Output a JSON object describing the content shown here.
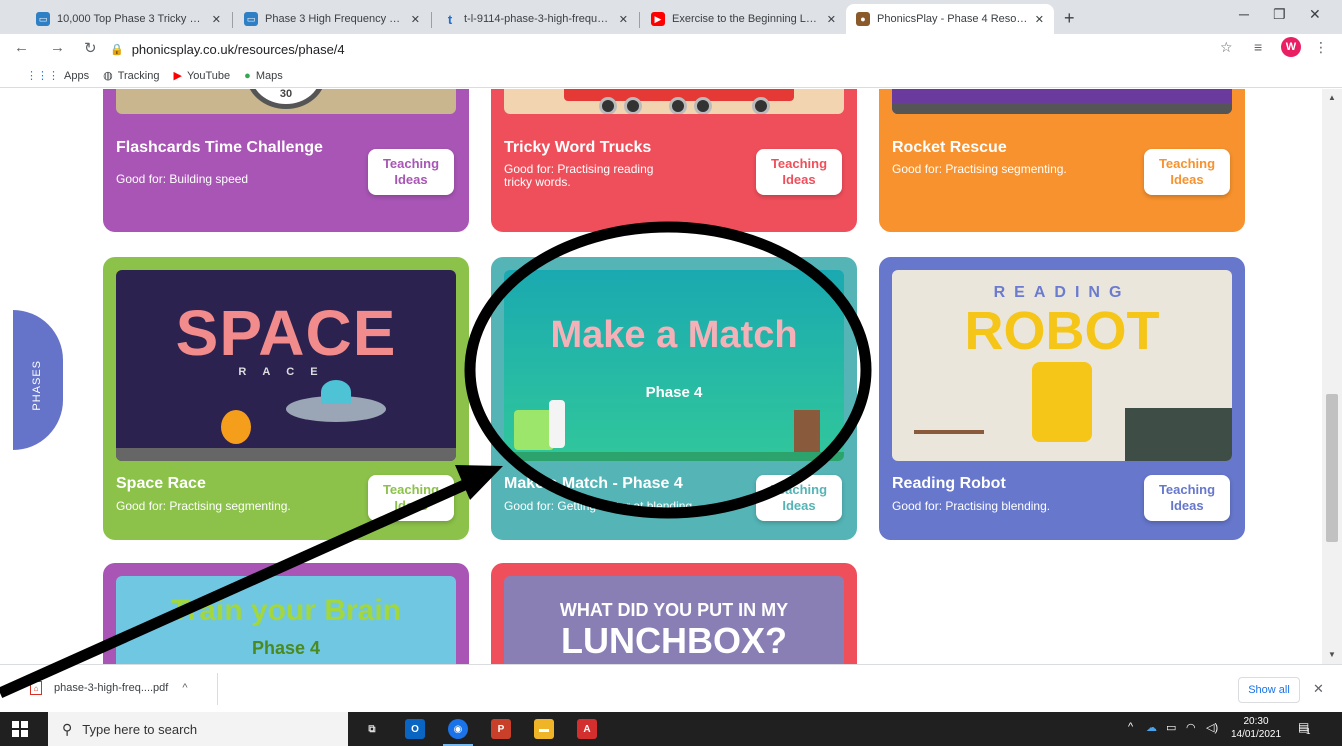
{
  "browser": {
    "tabs": [
      {
        "title": "10,000 Top Phase 3 Tricky Words",
        "favicon": "twinkl-icon",
        "color": "#2e7fc4",
        "active": false
      },
      {
        "title": "Phase 3 High Frequency Words a",
        "favicon": "twinkl-icon",
        "color": "#2e7fc4",
        "active": false
      },
      {
        "title": "t-l-9114-phase-3-high-frequenc",
        "favicon": "t-icon",
        "color": "#1d6fd1",
        "active": false
      },
      {
        "title": "Exercise to the Beginning Letter S",
        "favicon": "youtube-icon",
        "color": "#ff0000",
        "active": false
      },
      {
        "title": "PhonicsPlay - Phase 4 Resources",
        "favicon": "phonicsplay-icon",
        "color": "#8a5a2b",
        "active": true
      }
    ],
    "url": "phonicsplay.co.uk/resources/phase/4",
    "profile_initial": "W",
    "bookmarks": [
      {
        "label": "Apps",
        "icon": "apps-grid-icon"
      },
      {
        "label": "Tracking",
        "icon": "globe-icon"
      },
      {
        "label": "YouTube",
        "icon": "youtube-icon"
      },
      {
        "label": "Maps",
        "icon": "maps-pin-icon"
      }
    ]
  },
  "page": {
    "phases_tab_label": "PHASES",
    "teaching_ideas_label": "Teaching Ideas",
    "cards": [
      {
        "title": "Flashcards Time Challenge",
        "good_for": "Good for: Building speed",
        "bg": "#a855b5",
        "art_bg": "#c9b68f",
        "art_text": "30"
      },
      {
        "title": "Tricky Word Trucks",
        "good_for": "Good for: Practising reading tricky words.",
        "bg": "#ef4f5b",
        "art_bg": "#f2d4b0",
        "art_text": ""
      },
      {
        "title": "Rocket Rescue",
        "good_for": "Good for: Practising segmenting.",
        "bg": "#f7922e",
        "art_bg": "#6a3a9c",
        "art_text": ""
      },
      {
        "title": "Space Race",
        "good_for": "Good for: Practising segmenting.",
        "bg": "#8cc24a",
        "art_bg": "#2b2250",
        "art_text": "SPACE",
        "art_sub": "RACE"
      },
      {
        "title": "Make a Match - Phase 4",
        "good_for": "Good for: Getting better at blending.",
        "bg": "#55b4b6",
        "art_bg": "#1fb8b2",
        "art_text": "Make a Match",
        "art_sub": "Phase 4"
      },
      {
        "title": "Reading Robot",
        "good_for": "Good for: Practising blending.",
        "bg": "#6677cc",
        "art_bg": "#ebe6dc",
        "art_text": "ROBOT",
        "art_sub": "READING"
      },
      {
        "title": "",
        "good_for": "",
        "bg": "#a855b5",
        "art_bg": "#6fc7e2",
        "art_text": "Train your Brain",
        "art_sub": "Phase 4"
      },
      {
        "title": "",
        "good_for": "",
        "bg": "#ef4f5b",
        "art_bg": "#8a7fb5",
        "art_text": "LUNCHBOX?",
        "art_sub": "WHAT DID YOU PUT IN MY"
      }
    ]
  },
  "download_bar": {
    "file": "phase-3-high-freq....pdf",
    "show_all": "Show all"
  },
  "taskbar": {
    "search_placeholder": "Type here to search",
    "time": "20:30",
    "date": "14/01/2021",
    "notification_count": "1"
  }
}
